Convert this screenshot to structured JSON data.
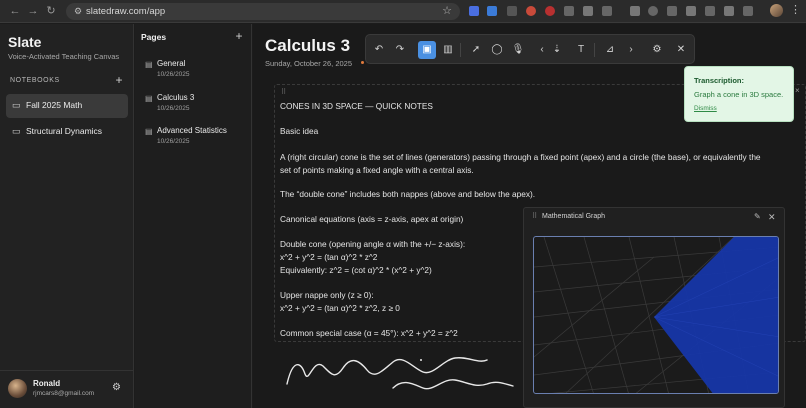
{
  "browser": {
    "url": "slatedraw.com/app"
  },
  "sidebar": {
    "brand": "Slate",
    "tagline": "Voice-Activated Teaching Canvas",
    "notebooks_heading": "NOTEBOOKS",
    "notebooks": [
      {
        "label": "Fall 2025 Math",
        "active": true
      },
      {
        "label": "Structural Dynamics",
        "active": false
      }
    ],
    "user": {
      "name": "Ronald",
      "email": "rjmcars8@gmail.com"
    }
  },
  "pages": {
    "heading": "Pages",
    "items": [
      {
        "title": "General",
        "date": "10/26/2025"
      },
      {
        "title": "Calculus 3",
        "date": "10/26/2025"
      },
      {
        "title": "Advanced Statistics",
        "date": "10/26/2025"
      }
    ]
  },
  "document": {
    "title": "Calculus 3",
    "date": "Sunday, October 26, 2025"
  },
  "toolbar": {
    "undo_icon": "undo-icon",
    "redo_icon": "redo-icon",
    "save_icon": "save-icon",
    "delete_icon": "trash-icon",
    "select_icon": "pointer-icon",
    "comment_icon": "comment-icon",
    "mic_icon": "mic-icon",
    "text_icon": "text-icon",
    "chart_icon": "chart-icon",
    "settings_icon": "gear-icon",
    "close_icon": "close-icon",
    "active_color": "#4a90e2"
  },
  "notes": {
    "heading": "CONES IN 3D SPACE — QUICK NOTES",
    "sub": "Basic idea",
    "p1_line1": "A (right circular) cone is the set of lines (generators) passing through a fixed point (apex) and a circle (the base), or equivalently the",
    "p1_line2": "set of points making a fixed angle with a central axis.",
    "p2": "The “double cone” includes both nappes (above and below the apex).",
    "p3": "Canonical equations (axis = z-axis, apex at origin)",
    "p4_line1": "Double cone (opening angle α with the +/− z-axis):",
    "p4_line2": "x^2 + y^2 = (tan α)^2 * z^2",
    "p4_line3": "Equivalently: z^2 = (cot α)^2 * (x^2 + y^2)",
    "p5_line1": "Upper nappe only (z ≥ 0):",
    "p5_line2": "x^2 + y^2 = (tan α)^2 * z^2, z ≥ 0",
    "p6": "Common special case (α = 45°): x^2 + y^2 = z^2"
  },
  "graph_panel": {
    "title": "Mathematical Graph",
    "surface_color": "#1636a8"
  },
  "transcription": {
    "heading": "Transcription:",
    "body": "Graph a cone in 3D space.",
    "dismiss": "Dismiss"
  }
}
